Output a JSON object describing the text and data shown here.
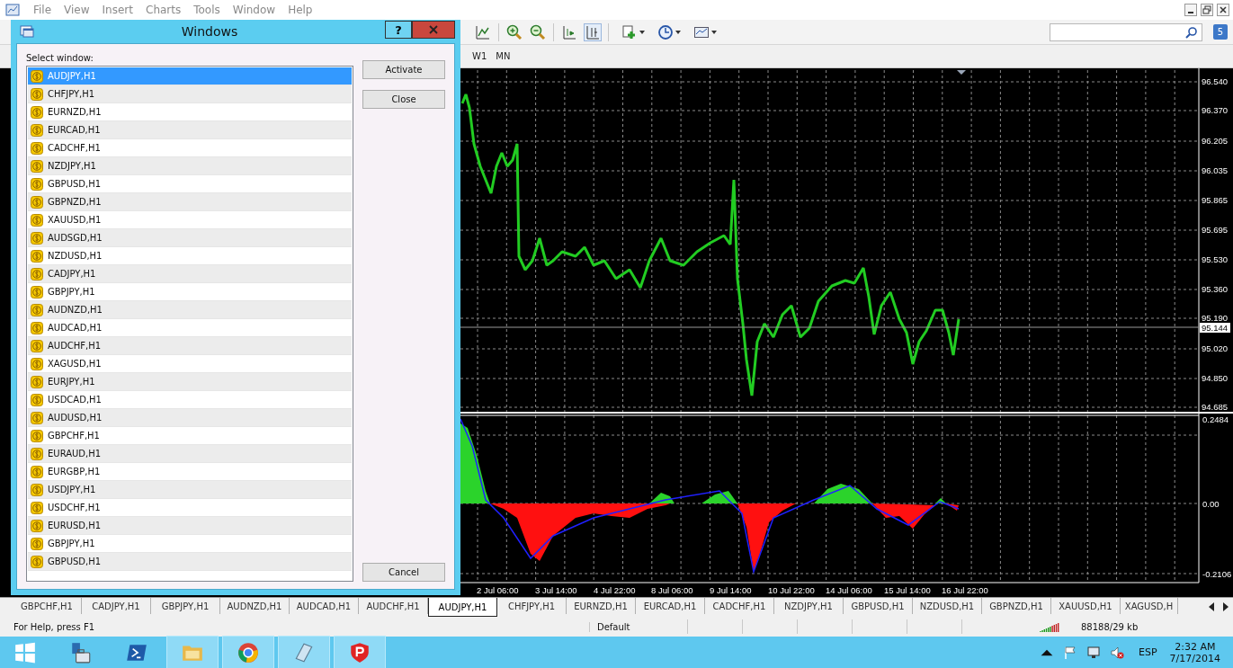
{
  "menu": [
    "File",
    "View",
    "Insert",
    "Charts",
    "Tools",
    "Window",
    "Help"
  ],
  "notifications": {
    "count": "5"
  },
  "timeframes": [
    "W1",
    "MN"
  ],
  "chart": {
    "price_labels": [
      "96.540",
      "96.370",
      "96.205",
      "96.035",
      "95.865",
      "95.695",
      "95.530",
      "95.360",
      "95.190",
      "95.020",
      "94.850",
      "94.685"
    ],
    "current_price": "95.144",
    "indicator_labels": [
      "0.2484",
      "0.00",
      "-0.2106"
    ],
    "time_labels": [
      "2 Jul 06:00",
      "3 Jul 14:00",
      "4 Jul 22:00",
      "8 Jul 06:00",
      "9 Jul 14:00",
      "10 Jul 22:00",
      "14 Jul 06:00",
      "15 Jul 14:00",
      "16 Jul 22:00"
    ]
  },
  "dialog": {
    "title": "Windows",
    "help": "?",
    "list_label": "Select window:",
    "windows": [
      {
        "label": "AUDJPY,H1",
        "selected": true
      },
      {
        "label": "CHFJPY,H1",
        "selected": false
      },
      {
        "label": "EURNZD,H1",
        "selected": false
      },
      {
        "label": "EURCAD,H1",
        "selected": false
      },
      {
        "label": "CADCHF,H1",
        "selected": false
      },
      {
        "label": "NZDJPY,H1",
        "selected": false
      },
      {
        "label": "GBPUSD,H1",
        "selected": false
      },
      {
        "label": "GBPNZD,H1",
        "selected": false
      },
      {
        "label": "XAUUSD,H1",
        "selected": false
      },
      {
        "label": "AUDSGD,H1",
        "selected": false
      },
      {
        "label": "NZDUSD,H1",
        "selected": false
      },
      {
        "label": "CADJPY,H1",
        "selected": false
      },
      {
        "label": "GBPJPY,H1",
        "selected": false
      },
      {
        "label": "AUDNZD,H1",
        "selected": false
      },
      {
        "label": "AUDCAD,H1",
        "selected": false
      },
      {
        "label": "AUDCHF,H1",
        "selected": false
      },
      {
        "label": "XAGUSD,H1",
        "selected": false
      },
      {
        "label": "EURJPY,H1",
        "selected": false
      },
      {
        "label": "USDCAD,H1",
        "selected": false
      },
      {
        "label": "AUDUSD,H1",
        "selected": false
      },
      {
        "label": "GBPCHF,H1",
        "selected": false
      },
      {
        "label": "EURAUD,H1",
        "selected": false
      },
      {
        "label": "EURGBP,H1",
        "selected": false
      },
      {
        "label": "USDJPY,H1",
        "selected": false
      },
      {
        "label": "USDCHF,H1",
        "selected": false
      },
      {
        "label": "EURUSD,H1",
        "selected": false
      },
      {
        "label": "GBPJPY,H1",
        "selected": false
      },
      {
        "label": "GBPUSD,H1",
        "selected": false
      }
    ],
    "buttons": [
      "Activate",
      "Close",
      "Cancel"
    ]
  },
  "tabs": [
    {
      "label": "GBPCHF,H1",
      "selected": false
    },
    {
      "label": "CADJPY,H1",
      "selected": false
    },
    {
      "label": "GBPJPY,H1",
      "selected": false
    },
    {
      "label": "AUDNZD,H1",
      "selected": false
    },
    {
      "label": "AUDCAD,H1",
      "selected": false
    },
    {
      "label": "AUDCHF,H1",
      "selected": false
    },
    {
      "label": "AUDJPY,H1",
      "selected": true
    },
    {
      "label": "CHFJPY,H1",
      "selected": false
    },
    {
      "label": "EURNZD,H1",
      "selected": false
    },
    {
      "label": "EURCAD,H1",
      "selected": false
    },
    {
      "label": "CADCHF,H1",
      "selected": false
    },
    {
      "label": "NZDJPY,H1",
      "selected": false
    },
    {
      "label": "GBPUSD,H1",
      "selected": false
    },
    {
      "label": "NZDUSD,H1",
      "selected": false
    },
    {
      "label": "GBPNZD,H1",
      "selected": false
    },
    {
      "label": "XAUUSD,H1",
      "selected": false
    },
    {
      "label": "XAGUSD,H",
      "selected": false
    }
  ],
  "status_bar": {
    "help": "For Help, press F1",
    "profile": "Default",
    "traffic": "88188/29 kb"
  },
  "taskbar": {
    "language": "ESP",
    "time": "2:32 AM",
    "date": "7/17/2014"
  }
}
